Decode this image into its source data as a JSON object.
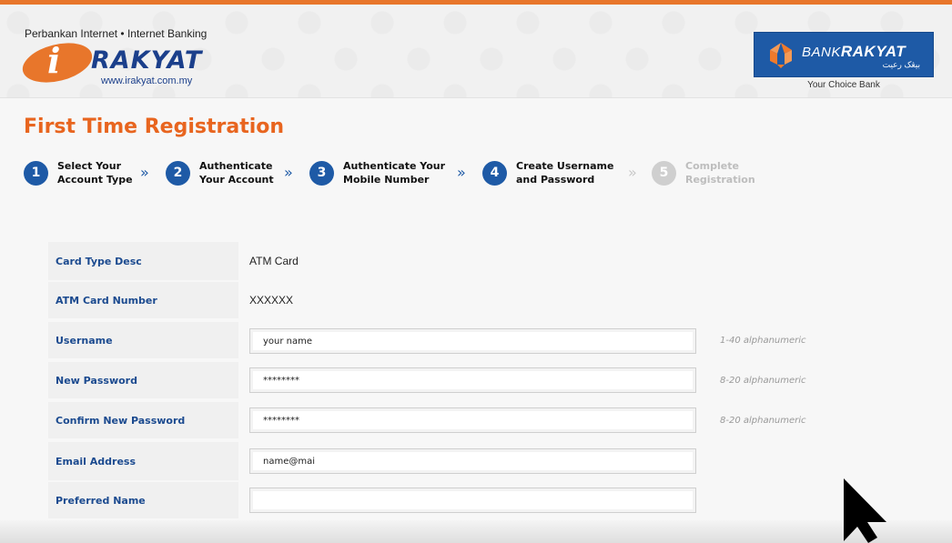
{
  "header": {
    "tagline": "Perbankan Internet • Internet Banking",
    "logo_i": "i",
    "logo_rakyat": "RAKYAT",
    "logo_url": "www.irakyat.com.my",
    "bank": {
      "name_prefix": "BANK",
      "name_bold": "RAKYAT",
      "jawi": "بيڠک رعيت",
      "slogan": "Your Choice Bank"
    }
  },
  "page_title": "First Time Registration",
  "steps": [
    {
      "num": "1",
      "label": "Select Your\nAccount Type",
      "active": true
    },
    {
      "num": "2",
      "label": "Authenticate\nYour Account",
      "active": true
    },
    {
      "num": "3",
      "label": "Authenticate Your\nMobile Number",
      "active": true
    },
    {
      "num": "4",
      "label": "Create Username\nand Password",
      "active": true
    },
    {
      "num": "5",
      "label": "Complete\nRegistration",
      "active": false
    }
  ],
  "step_arrow": "»",
  "form": {
    "card_type": {
      "label": "Card Type Desc",
      "value": "ATM Card"
    },
    "card_number": {
      "label": "ATM Card Number",
      "value": "XXXXXX"
    },
    "username": {
      "label": "Username",
      "value": "your name",
      "hint": "1-40 alphanumeric"
    },
    "new_password": {
      "label": "New Password",
      "value": "********",
      "hint": "8-20 alphanumeric"
    },
    "confirm_password": {
      "label": "Confirm New Password",
      "value": "********",
      "hint": "8-20 alphanumeric"
    },
    "email": {
      "label": "Email Address",
      "value": "name@mai"
    },
    "preferred_name": {
      "label": "Preferred Name",
      "value": ""
    }
  },
  "colors": {
    "accent_orange": "#e8651f",
    "brand_blue": "#1e5aa6",
    "label_blue": "#1b4a8f"
  }
}
